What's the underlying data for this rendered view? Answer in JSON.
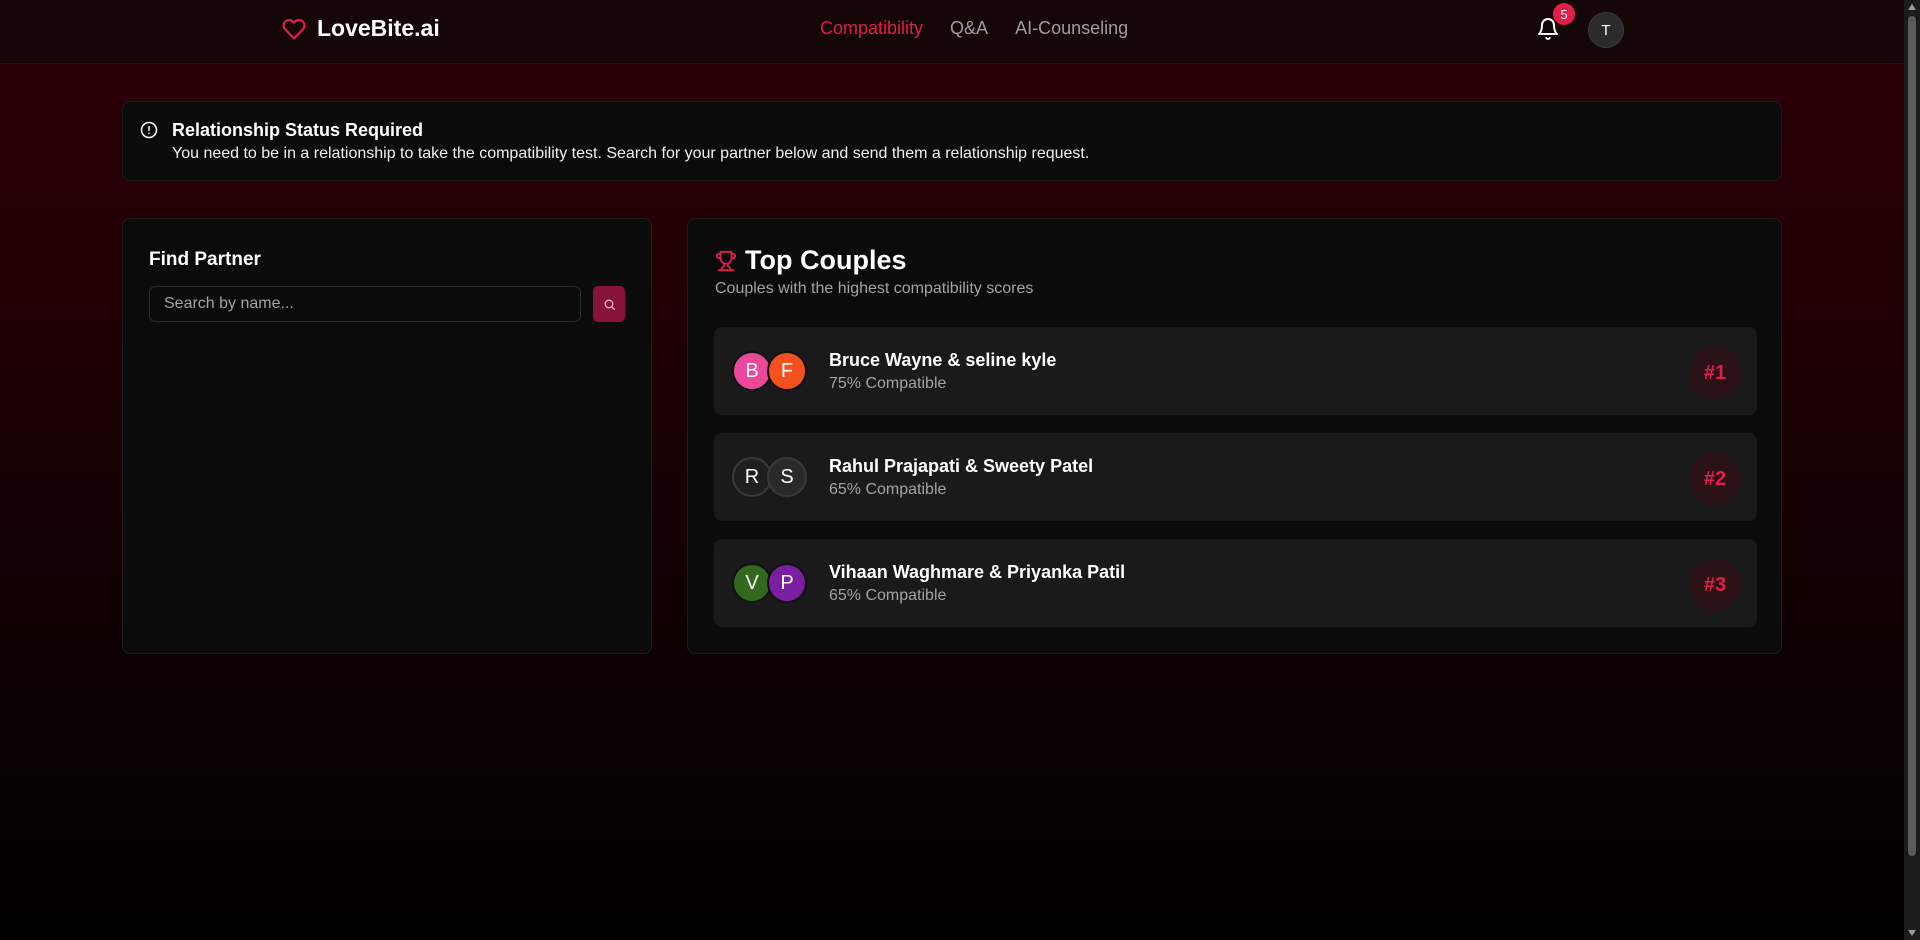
{
  "header": {
    "logo_text": "LoveBite.ai",
    "nav": [
      {
        "label": "Compatibility",
        "active": true
      },
      {
        "label": "Q&A",
        "active": false
      },
      {
        "label": "AI-Counseling",
        "active": false
      }
    ],
    "notification_count": "5",
    "user_initial": "T"
  },
  "alert": {
    "title": "Relationship Status Required",
    "description": "You need to be in a relationship to take the compatibility test. Search for your partner below and send them a relationship request."
  },
  "find_partner": {
    "title": "Find Partner",
    "search_placeholder": "Search by name..."
  },
  "top_couples": {
    "title": "Top Couples",
    "subtitle": "Couples with the highest compatibility scores",
    "couples": [
      {
        "initial1": "B",
        "color1": "#ec4899",
        "initial2": "F",
        "color2": "#f4511e",
        "names": "Bruce Wayne & seline kyle",
        "score": "75% Compatible",
        "rank": "#1"
      },
      {
        "initial1": "R",
        "color1": "#1f1f1f",
        "initial2": "S",
        "color2": "#2a2a2a",
        "names": "Rahul Prajapati & Sweety Patel",
        "score": "65% Compatible",
        "rank": "#2"
      },
      {
        "initial1": "V",
        "color1": "#33691e",
        "initial2": "P",
        "color2": "#7b1fa2",
        "names": "Vihaan Waghmare & Priyanka Patil",
        "score": "65% Compatible",
        "rank": "#3"
      }
    ]
  },
  "colors": {
    "accent": "#e11d48",
    "button": "#881337"
  }
}
